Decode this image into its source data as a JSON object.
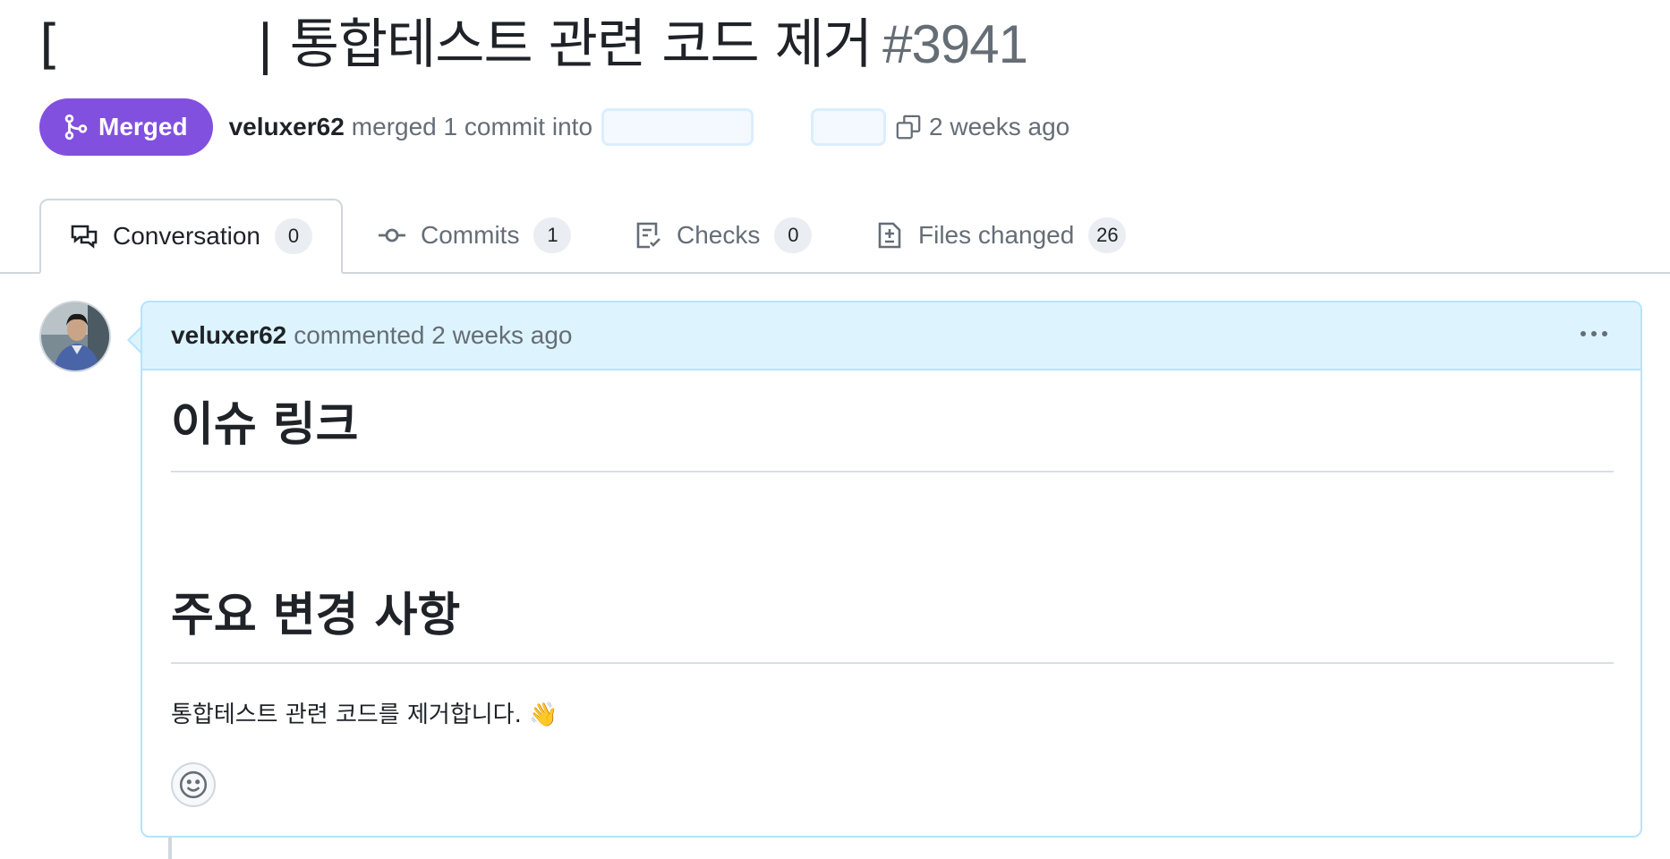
{
  "pr": {
    "title_prefix": "[",
    "title_text": "| 통합테스트 관련 코드 제거",
    "number": "#3941",
    "status": "Merged",
    "author": "veluxer62",
    "merge_text": "merged 1 commit into",
    "time": "2 weeks ago"
  },
  "tabs": [
    {
      "label": "Conversation",
      "count": "0",
      "icon": "comment-discussion-icon"
    },
    {
      "label": "Commits",
      "count": "1",
      "icon": "git-commit-icon"
    },
    {
      "label": "Checks",
      "count": "0",
      "icon": "checklist-icon"
    },
    {
      "label": "Files changed",
      "count": "26",
      "icon": "file-diff-icon"
    }
  ],
  "comment": {
    "author": "veluxer62",
    "action": "commented 2 weeks ago",
    "heading1": "이슈 링크",
    "heading2": "주요 변경 사항",
    "body": "통합테스트 관련 코드를 제거합니다. 👋"
  },
  "colors": {
    "merged": "#8250df",
    "comment_header": "#ddf4ff",
    "comment_border": "#b6e3ff"
  }
}
